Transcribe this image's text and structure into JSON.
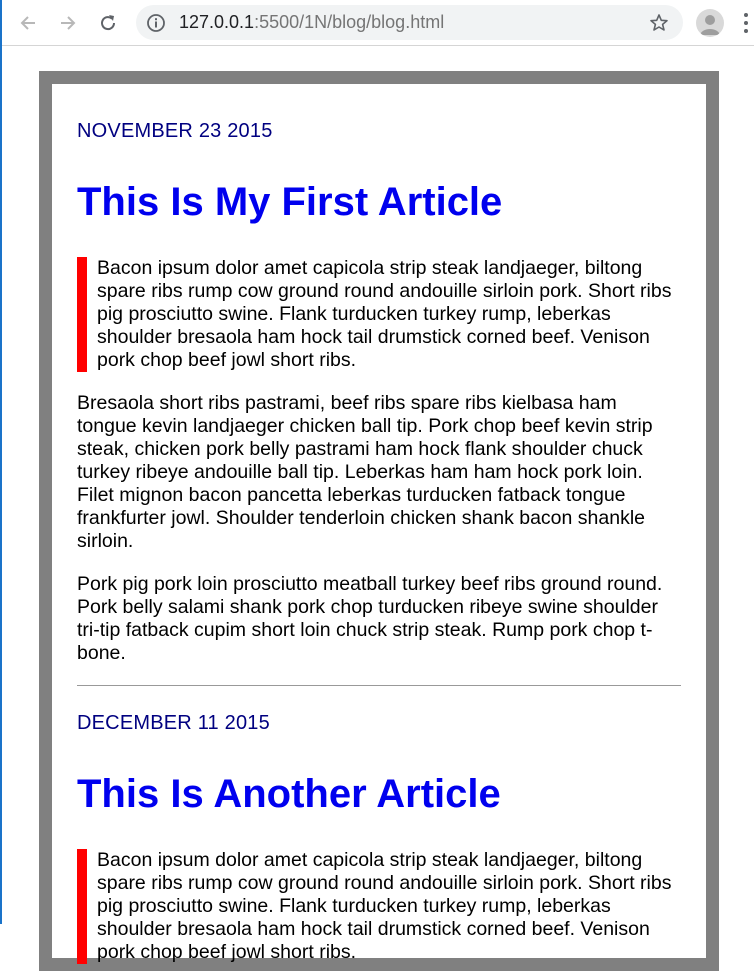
{
  "browser": {
    "url_host": "127.0.0.1",
    "url_rest": ":5500/1N/blog/blog.html"
  },
  "articles": [
    {
      "date": "NOVEMBER 23 2015",
      "title": "This Is My First Article",
      "quote": "Bacon ipsum dolor amet capicola strip steak landjaeger, biltong spare ribs rump cow ground round andouille sirloin pork. Short ribs pig prosciutto swine. Flank turducken turkey rump, leberkas shoulder bresaola ham hock tail drumstick corned beef. Venison pork chop beef jowl short ribs.",
      "paragraphs": [
        "Bresaola short ribs pastrami, beef ribs spare ribs kielbasa ham tongue kevin landjaeger chicken ball tip. Pork chop beef kevin strip steak, chicken pork belly pastrami ham hock flank shoulder chuck turkey ribeye andouille ball tip. Leberkas ham ham hock pork loin. Filet mignon bacon pancetta leberkas turducken fatback tongue frankfurter jowl. Shoulder tenderloin chicken shank bacon shankle sirloin.",
        "Pork pig pork loin prosciutto meatball turkey beef ribs ground round. Pork belly salami shank pork chop turducken ribeye swine shoulder tri-tip fatback cupim short loin chuck strip steak. Rump pork chop t-bone."
      ]
    },
    {
      "date": "DECEMBER 11 2015",
      "title": "This Is Another Article",
      "quote": "Bacon ipsum dolor amet capicola strip steak landjaeger, biltong spare ribs rump cow ground round andouille sirloin pork. Short ribs pig prosciutto swine. Flank turducken turkey rump, leberkas shoulder bresaola ham hock tail drumstick corned beef. Venison pork chop beef jowl short ribs."
    }
  ],
  "colors": {
    "date": "#000080",
    "title": "#0000ee",
    "quote_border": "#ff0000",
    "frame_border": "#808080"
  },
  "icons": {
    "back": "back-arrow-icon",
    "forward": "forward-arrow-icon",
    "reload": "reload-icon",
    "info": "info-icon",
    "bookmark": "star-icon",
    "profile": "avatar-icon",
    "menu": "menu-dots-icon"
  }
}
